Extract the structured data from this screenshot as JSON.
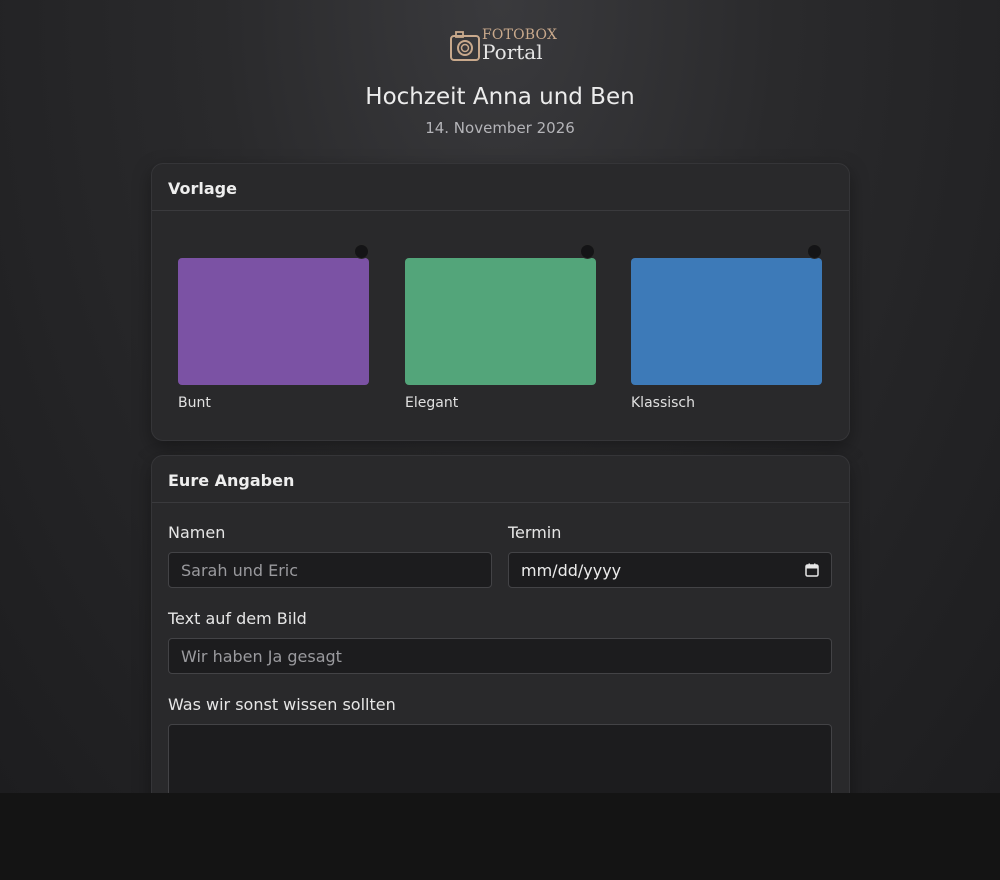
{
  "logo": {
    "line1": "FOTOBOX",
    "line2": "Portal"
  },
  "header": {
    "title": "Hochzeit Anna und Ben",
    "date": "14. November 2026"
  },
  "template_section": {
    "title": "Vorlage",
    "templates": [
      {
        "label": "Bunt",
        "color": "#7b52a4"
      },
      {
        "label": "Elegant",
        "color": "#53a57a"
      },
      {
        "label": "Klassisch",
        "color": "#3d7ab8"
      }
    ]
  },
  "details_section": {
    "title": "Eure Angaben",
    "names": {
      "label": "Namen",
      "placeholder": "Sarah und Eric",
      "value": ""
    },
    "date": {
      "label": "Termin",
      "placeholder": "mm/dd/yyyy"
    },
    "image_text": {
      "label": "Text auf dem Bild",
      "placeholder": "Wir haben Ja gesagt",
      "value": ""
    },
    "notes": {
      "label": "Was wir sonst wissen sollten",
      "value": ""
    }
  }
}
